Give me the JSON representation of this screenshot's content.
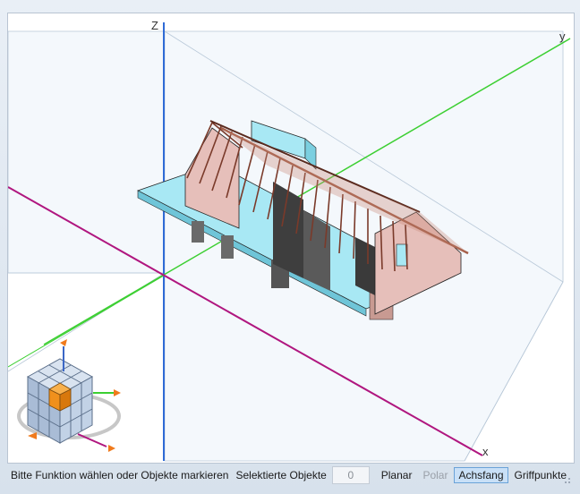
{
  "viewport": {
    "axis_labels": {
      "z": "Z",
      "y": "y",
      "x": "x"
    },
    "colors": {
      "z_axis": "#2f6bd6",
      "y_axis": "#3ccf32",
      "x_axis": "#b0167f",
      "grid": "#b8c8d8"
    }
  },
  "navigation_cube": {
    "icon": "view-cube-icon"
  },
  "statusbar": {
    "message": "Bitte Funktion wählen oder Objekte markieren",
    "selected_label": "Selektierte Objekte",
    "selected_count": "0",
    "toggles": [
      {
        "label": "Planar",
        "state": "normal"
      },
      {
        "label": "Polar",
        "state": "disabled"
      },
      {
        "label": "Achsfang",
        "state": "active"
      },
      {
        "label": "Griffpunkte",
        "state": "normal"
      }
    ]
  }
}
